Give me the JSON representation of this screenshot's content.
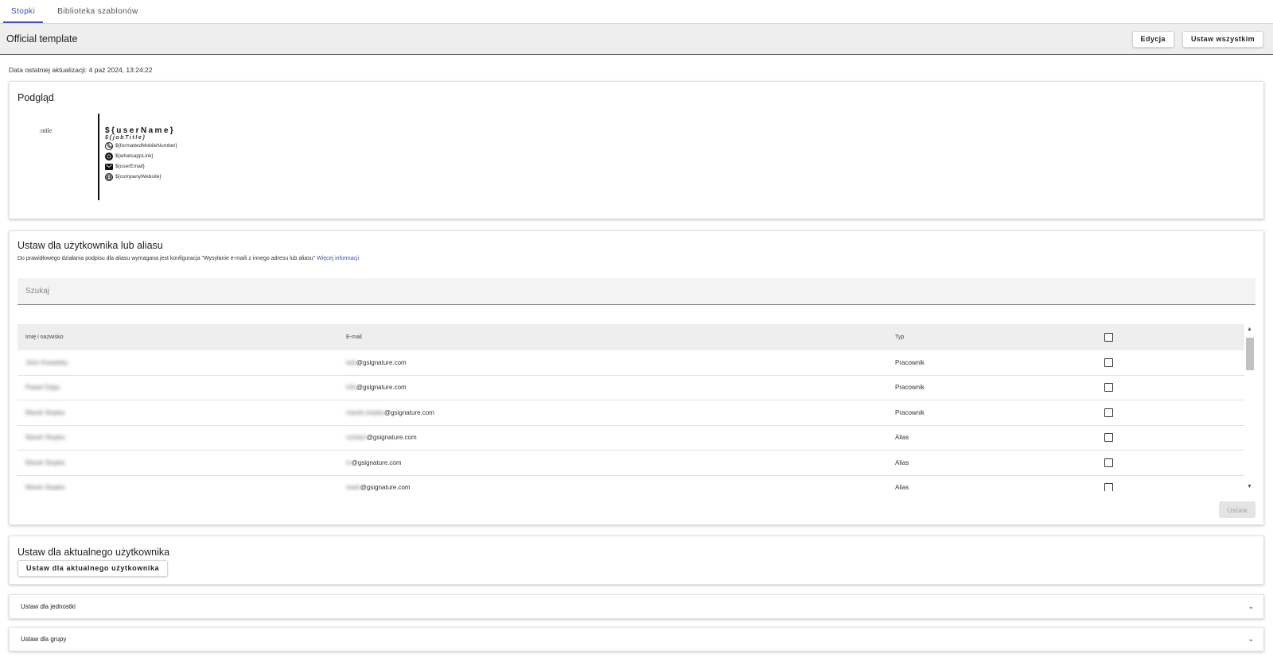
{
  "tabs": [
    {
      "label": "Stopki",
      "active": true
    },
    {
      "label": "Biblioteka szablonów",
      "active": false
    }
  ],
  "header": {
    "title": "Official template",
    "edit_label": "Edycja",
    "set_all_label": "Ustaw wszystkim"
  },
  "updated_text": "Data ostatniej aktualizacji: 4 paź 2024, 13:24:22",
  "preview": {
    "title": "Podgląd",
    "logo_alt": "ːotile",
    "name": "${userName}",
    "job": "${jobTitle}",
    "lines": [
      {
        "icon": "phone-icon",
        "text": "${formattedMobileNumber}"
      },
      {
        "icon": "whatsapp-icon",
        "text": "${whatsappLink}"
      },
      {
        "icon": "mail-icon",
        "text": "${userEmail}"
      },
      {
        "icon": "globe-icon",
        "text": "${companyWebsite}"
      }
    ]
  },
  "users": {
    "title": "Ustaw dla użytkownika lub aliasu",
    "info": "Do prawidłowego działania podpisu dla aliasu wymagana jest konfiguracja \"Wysyłanie e-maili z innego adresu lub aliasu\"",
    "info_link": "Więcej informacji",
    "search_placeholder": "Szukaj",
    "columns": {
      "name": "Imię i nazwisko",
      "email": "E-mail",
      "type": "Typ"
    },
    "rows": [
      {
        "name": "John Kowalsky",
        "email_local": "test",
        "email_domain": "@gsignature.com",
        "type": "Pracownik"
      },
      {
        "name": "Paweł Zając",
        "email_local": "info",
        "email_domain": "@gsignature.com",
        "type": "Pracownik"
      },
      {
        "name": "Marek Stopka",
        "email_local": "marek.stopka",
        "email_domain": "@gsignature.com",
        "type": "Pracownik"
      },
      {
        "name": "Marek Stopka",
        "email_local": "contact",
        "email_domain": "@gsignature.com",
        "type": "Alias"
      },
      {
        "name": "Marek Stopka",
        "email_local": "m",
        "email_domain": "@gsignature.com",
        "type": "Alias"
      },
      {
        "name": "Marek Stopka",
        "email_local": "mark",
        "email_domain": "@gsignature.com",
        "type": "Alias"
      }
    ],
    "apply_label": "Ustaw"
  },
  "current_user": {
    "title": "Ustaw dla aktualnego użytkownika",
    "button_label": "Ustaw dla aktualnego użytkownika"
  },
  "accordions": [
    {
      "label": "Ustaw dla jednostki"
    },
    {
      "label": "Ustaw dla grupy"
    }
  ],
  "colors": {
    "accent": "#3f51b5",
    "header_bg": "#eeeeee"
  }
}
